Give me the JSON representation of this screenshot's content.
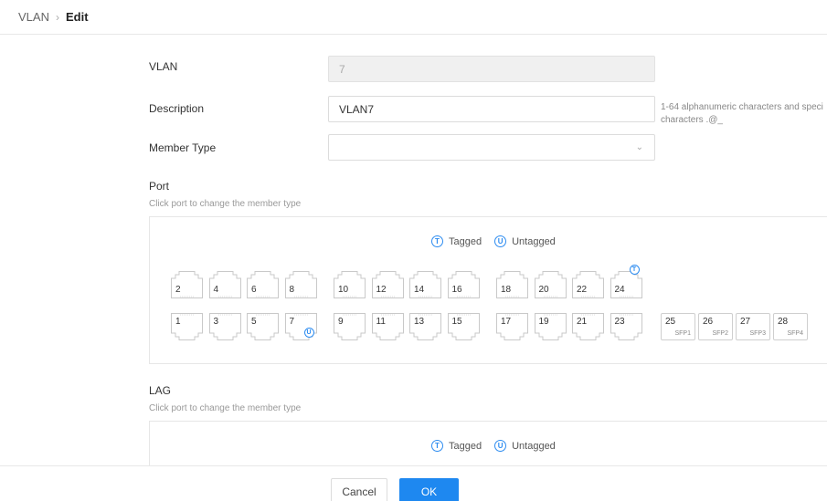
{
  "breadcrumb": {
    "parent": "VLAN",
    "separator": "›",
    "current": "Edit"
  },
  "form": {
    "vlan_label": "VLAN",
    "vlan_value": "7",
    "description_label": "Description",
    "description_value": "VLAN7",
    "description_hint": "1-64 alphanumeric characters and speci characters .@_",
    "member_type_label": "Member Type",
    "member_type_value": ""
  },
  "port_section": {
    "title": "Port",
    "subtitle": "Click port to change the member type",
    "legend_tagged": "Tagged",
    "legend_untagged": "Untagged",
    "legend_tagged_symbol": "T",
    "legend_untagged_symbol": "U"
  },
  "ports_top": [
    {
      "n": "2",
      "m": ""
    },
    {
      "n": "4",
      "m": ""
    },
    {
      "n": "6",
      "m": ""
    },
    {
      "n": "8",
      "m": ""
    },
    {
      "n": "10",
      "m": ""
    },
    {
      "n": "12",
      "m": ""
    },
    {
      "n": "14",
      "m": ""
    },
    {
      "n": "16",
      "m": ""
    },
    {
      "n": "18",
      "m": ""
    },
    {
      "n": "20",
      "m": ""
    },
    {
      "n": "22",
      "m": ""
    },
    {
      "n": "24",
      "m": "T"
    }
  ],
  "ports_bottom": [
    {
      "n": "1",
      "m": ""
    },
    {
      "n": "3",
      "m": ""
    },
    {
      "n": "5",
      "m": ""
    },
    {
      "n": "7",
      "m": "U"
    },
    {
      "n": "9",
      "m": ""
    },
    {
      "n": "11",
      "m": ""
    },
    {
      "n": "13",
      "m": ""
    },
    {
      "n": "15",
      "m": ""
    },
    {
      "n": "17",
      "m": ""
    },
    {
      "n": "19",
      "m": ""
    },
    {
      "n": "21",
      "m": ""
    },
    {
      "n": "23",
      "m": ""
    }
  ],
  "sfp_ports": [
    {
      "n": "25",
      "sub": "SFP1"
    },
    {
      "n": "26",
      "sub": "SFP2"
    },
    {
      "n": "27",
      "sub": "SFP3"
    },
    {
      "n": "28",
      "sub": "SFP4"
    }
  ],
  "lag_section": {
    "title": "LAG",
    "subtitle": "Click port to change the member type",
    "legend_tagged": "Tagged",
    "legend_untagged": "Untagged",
    "legend_tagged_symbol": "T",
    "legend_untagged_symbol": "U"
  },
  "buttons": {
    "cancel": "Cancel",
    "ok": "OK"
  },
  "colors": {
    "accent": "#1e88f0",
    "icon": "#2d8cf0"
  }
}
